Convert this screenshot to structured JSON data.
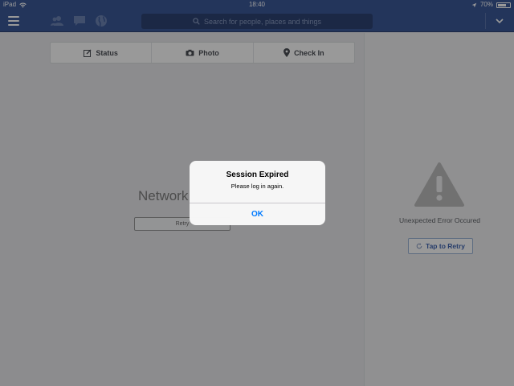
{
  "status_bar": {
    "device": "iPad",
    "time": "18:40",
    "battery": "70%",
    "battery_level": 0.7
  },
  "nav": {
    "search_placeholder": "Search for people, places and things"
  },
  "composer": {
    "status_label": "Status",
    "photo_label": "Photo",
    "checkin_label": "Check In"
  },
  "feed": {
    "network_title": "Network",
    "retry_label": "Retry"
  },
  "side": {
    "error_text": "Unexpected Error Occured",
    "tap_retry_label": "Tap to Retry"
  },
  "alert": {
    "title": "Session Expired",
    "message": "Please log in again.",
    "ok_label": "OK"
  },
  "colors": {
    "brand": "#3b5998",
    "ios_blue": "#007aff",
    "link_blue": "#4267b2"
  }
}
